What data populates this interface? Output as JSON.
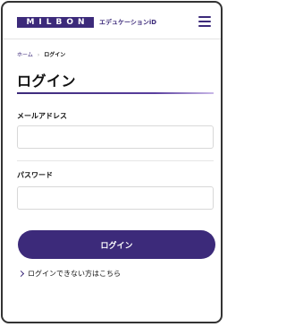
{
  "header": {
    "logo_text": "MILBON",
    "logo_sub": "エデュケーションiD",
    "menu_icon": "hamburger-menu-icon"
  },
  "breadcrumb": {
    "home": "ホーム",
    "separator": "›",
    "current": "ログイン"
  },
  "page": {
    "title": "ログイン"
  },
  "form": {
    "email_label": "メールアドレス",
    "email_value": "",
    "password_label": "パスワード",
    "password_value": "",
    "submit_label": "ログイン",
    "help_link": "ログインできない方はこちら"
  },
  "colors": {
    "brand": "#3c2a7a",
    "border": "#333333"
  }
}
